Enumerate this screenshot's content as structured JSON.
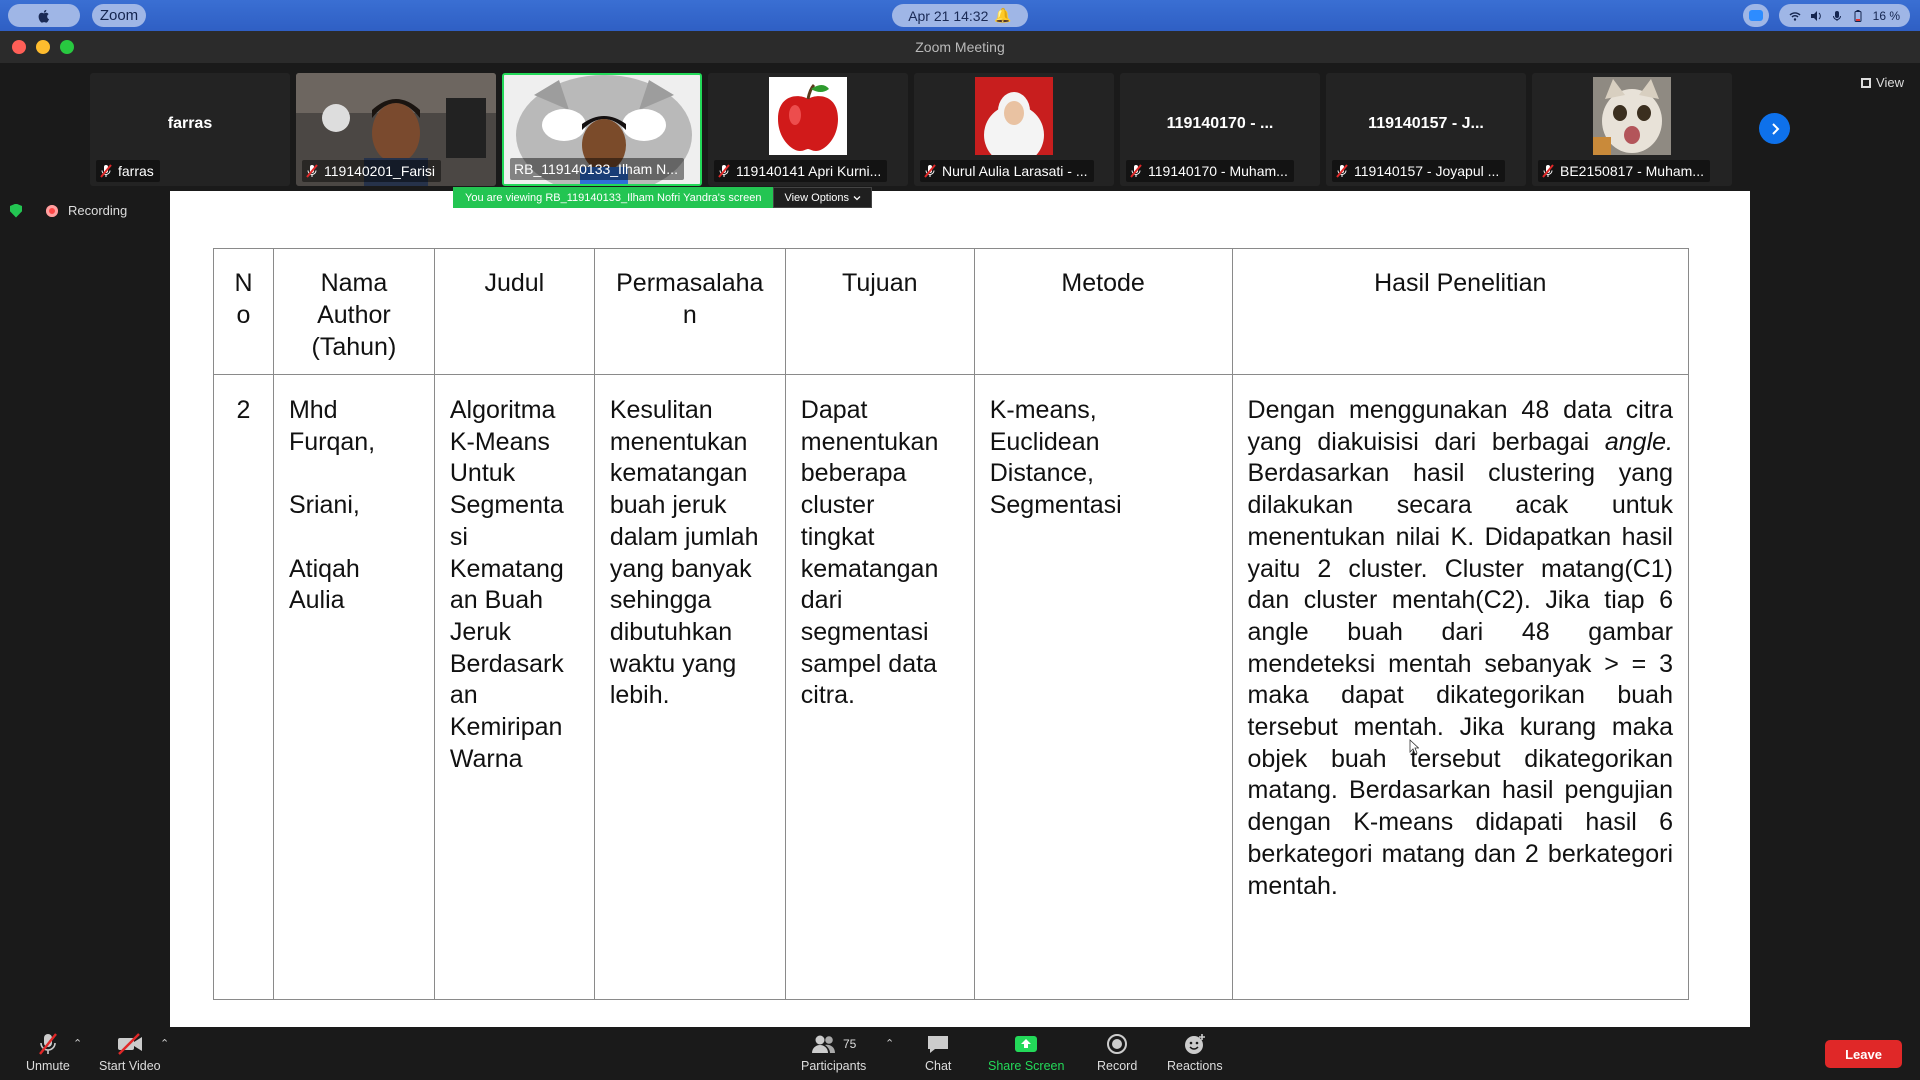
{
  "os_bar": {
    "app_menu": "Zoom",
    "clock": "Apr 21  14:32",
    "battery": "16 %"
  },
  "window": {
    "title": "Zoom Meeting"
  },
  "gallery": {
    "view_label": "View",
    "tiles": [
      {
        "display": "farras",
        "label": "farras",
        "kind": "name"
      },
      {
        "display": "",
        "label": "119140201_Farisi",
        "kind": "video"
      },
      {
        "display": "",
        "label": "RB_119140133_Ilham N...",
        "kind": "video-active"
      },
      {
        "display": "",
        "label": "119140141 Apri Kurni...",
        "kind": "apple"
      },
      {
        "display": "",
        "label": "Nurul Aulia Larasati - ...",
        "kind": "portrait"
      },
      {
        "display": "119140170 - ...",
        "label": "119140170 - Muham...",
        "kind": "name"
      },
      {
        "display": "119140157 - J...",
        "label": "119140157 - Joyapul ...",
        "kind": "name"
      },
      {
        "display": "",
        "label": "BE2150817 - Muham...",
        "kind": "cat"
      }
    ]
  },
  "share_banner": {
    "message": "You are viewing RB_119140133_Ilham Nofri Yandra's screen",
    "options": "View Options"
  },
  "recording": {
    "label": "Recording"
  },
  "document": {
    "headers": [
      "N\no",
      "Nama\nAuthor\n(Tahun)",
      "Judul",
      "Permasalaha\nn",
      "Tujuan",
      "Metode",
      "Hasil Penelitian"
    ],
    "row": {
      "no": "2",
      "author": "Mhd\nFurqan,\n\nSriani,\n\nAtiqah\nAulia",
      "judul": "Algoritma\nK-Means\nUntuk\nSegmenta\nsi\nKematang\nan Buah\nJeruk\nBerdasark\nan\nKemiripan\nWarna",
      "permasalahan": "Kesulitan\nmenentukan\nkematangan\nbuah jeruk\ndalam jumlah\nyang banyak\nsehingga\ndibutuhkan\nwaktu yang\nlebih.",
      "tujuan": "Dapat\nmenentukan\nbeberapa\ncluster\ntingkat\nkematangan\ndari\nsegmentasi\nsampel   data\ncitra.",
      "metode": "K-means,\nEuclidean\nDistance,\nSegmentasi",
      "hasil_pre": "Dengan menggunakan 48 data citra yang diakuisisi dari berbagai ",
      "hasil_italic": "angle.",
      "hasil_post": " Berdasarkan hasil clustering yang dilakukan secara acak untuk menentukan nilai K. Didapatkan hasil yaitu 2 cluster. Cluster matang(C1) dan cluster mentah(C2). Jika tiap 6 angle buah dari 48 gambar mendeteksi mentah sebanyak > = 3 maka dapat dikategorikan buah tersebut mentah. Jika kurang maka objek buah tersebut dikategorikan matang. Berdasarkan hasil pengujian dengan K-means didapati hasil 6 berkategori matang dan 2 berkategori mentah."
    }
  },
  "toolbar": {
    "unmute": "Unmute",
    "start_video": "Start Video",
    "participants": "Participants",
    "participant_count": "75",
    "chat": "Chat",
    "share_screen": "Share Screen",
    "record": "Record",
    "reactions": "Reactions",
    "leave": "Leave"
  },
  "colors": {
    "active_border": "#23d959",
    "leave": "#e02828",
    "blue_accent": "#0e71eb"
  }
}
